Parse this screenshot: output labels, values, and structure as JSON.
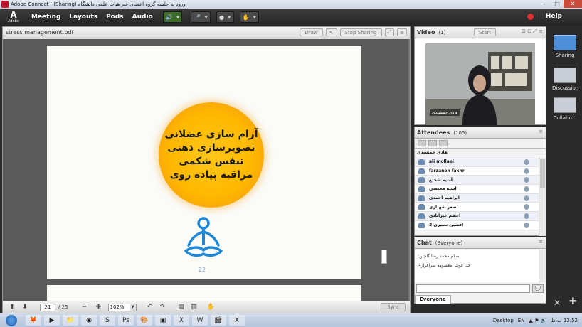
{
  "window": {
    "title": "ورود به جلسه  گروه اعضای غیر هیات علمی دانشگاه (Sharing) - Adobe Connect",
    "buttons": [
      "–",
      "□",
      "✕"
    ]
  },
  "menubar": {
    "logo_letter": "A",
    "logo_text": "Adobe",
    "items": [
      "Meeting",
      "Layouts",
      "Pods",
      "Audio"
    ],
    "help": "Help"
  },
  "share_pod": {
    "filename": "stress management.pdf",
    "draw_label": "Draw",
    "stop_sharing_label": "Stop Sharing",
    "slide_lines": [
      "آرام سازی عضلانی",
      "تصویرسازی ذهنی",
      "تنفس شکمی",
      "مراقبه پیاده روی"
    ],
    "slide_page_number": "22",
    "current_page": "21",
    "total_pages": "/ 25",
    "zoom": "102%",
    "sync_label": "Sync"
  },
  "video_pod": {
    "title": "Video",
    "count": "(1)",
    "start_label": "Start",
    "participant_name": "هادی جمشیدی"
  },
  "attendees_pod": {
    "title": "Attendees",
    "count": "(105)",
    "host": "هادی جمشیدی",
    "rows": [
      "ali mollaei",
      "farzaneh fakhr",
      "آسیه شجیع",
      "آسیه مختصی",
      "ابراهیم احمدی",
      "اصغر شهبازی",
      "اعظم غیرآبادی",
      "افشین نصیری 2"
    ]
  },
  "chat_pod": {
    "title": "Chat",
    "audience": "(Everyone)",
    "messages": [
      "سلام محمد رضا گلچین:",
      "خدا قوت :معصومه سرافرازی"
    ],
    "tab_label": "Everyone"
  },
  "layouts": [
    {
      "label": "Sharing",
      "active": true
    },
    {
      "label": "Discussion",
      "active": false
    },
    {
      "label": "Collabo...",
      "active": false
    }
  ],
  "taskbar": {
    "desktop_label": "Desktop",
    "lang": "EN",
    "time": "12:52 ب.ظ"
  },
  "colors": {
    "accent_blue": "#4e8fd8",
    "slide_circle": "#ffb800",
    "record_red": "#e03030"
  }
}
